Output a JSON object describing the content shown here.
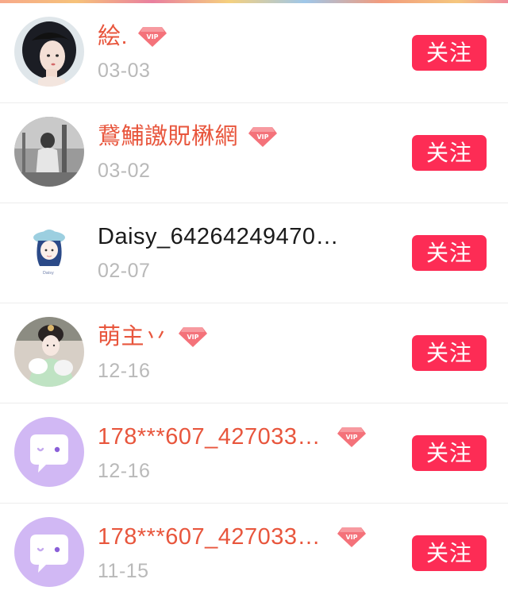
{
  "follow_label": "关注",
  "vip_text": "VIP",
  "colors": {
    "follow_bg": "#fd2c55",
    "vip_name": "#e8563d",
    "date": "#b9b9b9"
  },
  "users": [
    {
      "name": "絵.",
      "vip": true,
      "date": "03-03",
      "avatar": "girl-portrait-avatar"
    },
    {
      "name": "鵞鯆譤貺楙網",
      "vip": true,
      "date": "03-02",
      "avatar": "grayscale-photo-avatar"
    },
    {
      "name": "Daisy_64264249470…",
      "vip": false,
      "date": "02-07",
      "avatar": "drawn-girl-hat-avatar"
    },
    {
      "name": "萌主丷",
      "vip": true,
      "date": "12-16",
      "avatar": "costume-girl-avatar"
    },
    {
      "name": "178***607_427033…",
      "vip": true,
      "date": "12-16",
      "avatar": "chat-bubble-avatar"
    },
    {
      "name": "178***607_427033…",
      "vip": true,
      "date": "11-15",
      "avatar": "chat-bubble-avatar"
    }
  ]
}
